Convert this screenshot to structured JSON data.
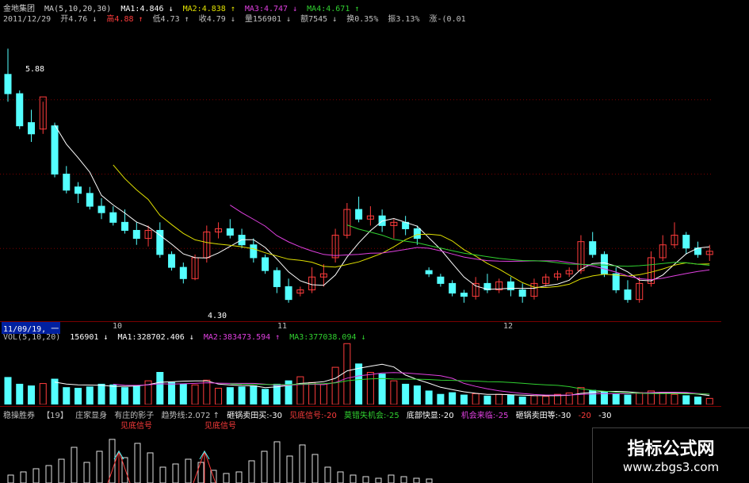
{
  "colors": {
    "bg": "#000000",
    "up": "#ff3c3c",
    "down": "#54ffff",
    "ma5": "#ffffff",
    "ma10": "#e0e000",
    "ma20": "#e040e0",
    "ma30": "#30d030",
    "grid": "#7a0000",
    "text": "#c0c0c0"
  },
  "header": {
    "stock_name": "金地集团",
    "ma_label": "MA(5,10,20,30)",
    "ma1": "MA1:4.846 ↓",
    "ma2": "MA2:4.838 ↑",
    "ma3": "MA3:4.747 ↓",
    "ma4": "MA4:4.671 ↑",
    "date": "2011/12/29",
    "open": "开4.76 ↓",
    "high": "高4.88 ↑",
    "low": "低4.73 ↑",
    "close": "收4.79 ↓",
    "volume": "量156901 ↓",
    "amount": "额7545 ↓",
    "turnover": "换0.35%",
    "amplitude": "振3.13%",
    "change": "涨-(0.01"
  },
  "price_labels": {
    "high_mark": "5.88",
    "low_mark": "4.30"
  },
  "date_axis": {
    "cursor": "11/09/19, 一",
    "m10": "10",
    "m11": "11",
    "m12": "12"
  },
  "volume_header": {
    "label": "VOL(5,10,20)",
    "vol": "156901 ↓",
    "ma1": "MA1:328702.406 ↓",
    "ma2": "MA2:383473.594 ↑",
    "ma3": "MA3:377038.094 ↓"
  },
  "indicator_header": {
    "name": "稳操胜券",
    "param": "【19】",
    "text1": "庄家显身",
    "text2": "有庄的影子",
    "text3": "趋势线:2.072 ↑",
    "text4": "砸锅卖田买:-30",
    "text5": "见底信号:-20",
    "text6": "莫错失机会:-25",
    "text7": "底部快显:-20",
    "text8": "机会来临:-25",
    "text9": "砸锅卖田等:-30",
    "text10": "-20",
    "text11": "-30"
  },
  "signals": [
    "见底信号",
    "见底信号"
  ],
  "watermark": {
    "title": "指标公式网",
    "url": "www.zbgs3.com"
  },
  "chart_data": {
    "type": "candlestick",
    "candles": [
      [
        5.72,
        5.88,
        5.6,
        5.55
      ],
      [
        5.6,
        5.62,
        5.4,
        5.38
      ],
      [
        5.42,
        5.5,
        5.35,
        5.3
      ],
      [
        5.38,
        5.55,
        5.58,
        5.35
      ],
      [
        5.4,
        5.42,
        5.1,
        5.08
      ],
      [
        5.1,
        5.15,
        5.0,
        4.98
      ],
      [
        5.02,
        5.05,
        4.98,
        4.92
      ],
      [
        4.98,
        5.02,
        4.9,
        4.88
      ],
      [
        4.9,
        4.95,
        4.86,
        4.82
      ],
      [
        4.86,
        4.9,
        4.8,
        4.78
      ],
      [
        4.8,
        4.88,
        4.75,
        4.73
      ],
      [
        4.75,
        4.8,
        4.7,
        4.66
      ],
      [
        4.7,
        4.78,
        4.75,
        4.65
      ],
      [
        4.75,
        4.8,
        4.6,
        4.58
      ],
      [
        4.6,
        4.62,
        4.52,
        4.5
      ],
      [
        4.52,
        4.55,
        4.45,
        4.42
      ],
      [
        4.45,
        4.6,
        4.58,
        4.44
      ],
      [
        4.58,
        4.78,
        4.74,
        4.55
      ],
      [
        4.74,
        4.8,
        4.76,
        4.7
      ],
      [
        4.76,
        4.82,
        4.72,
        4.7
      ],
      [
        4.72,
        4.76,
        4.66,
        4.64
      ],
      [
        4.66,
        4.7,
        4.58,
        4.55
      ],
      [
        4.58,
        4.6,
        4.5,
        4.48
      ],
      [
        4.5,
        4.52,
        4.4,
        4.36
      ],
      [
        4.4,
        4.45,
        4.32,
        4.3
      ],
      [
        4.36,
        4.4,
        4.38,
        4.34
      ],
      [
        4.38,
        4.52,
        4.46,
        4.36
      ],
      [
        4.46,
        4.54,
        4.48,
        4.4
      ],
      [
        4.58,
        4.76,
        4.72,
        4.55
      ],
      [
        4.72,
        4.92,
        4.88,
        4.7
      ],
      [
        4.88,
        4.96,
        4.82,
        4.8
      ],
      [
        4.82,
        4.9,
        4.84,
        4.78
      ],
      [
        4.84,
        4.88,
        4.78,
        4.74
      ],
      [
        4.78,
        4.82,
        4.8,
        4.7
      ],
      [
        4.8,
        4.84,
        4.76,
        4.72
      ],
      [
        4.76,
        4.78,
        4.7,
        4.66
      ],
      [
        4.5,
        4.52,
        4.48,
        4.46
      ],
      [
        4.46,
        4.48,
        4.42,
        4.4
      ],
      [
        4.42,
        4.44,
        4.36,
        4.34
      ],
      [
        4.36,
        4.38,
        4.34,
        4.3
      ],
      [
        4.34,
        4.46,
        4.42,
        4.32
      ],
      [
        4.42,
        4.48,
        4.38,
        4.36
      ],
      [
        4.38,
        4.45,
        4.43,
        4.36
      ],
      [
        4.43,
        4.46,
        4.38,
        4.34
      ],
      [
        4.38,
        4.42,
        4.34,
        4.3
      ],
      [
        4.34,
        4.45,
        4.42,
        4.32
      ],
      [
        4.42,
        4.48,
        4.46,
        4.4
      ],
      [
        4.46,
        4.5,
        4.48,
        4.44
      ],
      [
        4.48,
        4.52,
        4.5,
        4.46
      ],
      [
        4.5,
        4.72,
        4.68,
        4.48
      ],
      [
        4.68,
        4.74,
        4.6,
        4.58
      ],
      [
        4.6,
        4.62,
        4.48,
        4.46
      ],
      [
        4.48,
        4.52,
        4.38,
        4.36
      ],
      [
        4.38,
        4.44,
        4.32,
        4.3
      ],
      [
        4.32,
        4.46,
        4.42,
        4.3
      ],
      [
        4.42,
        4.62,
        4.58,
        4.4
      ],
      [
        4.58,
        4.72,
        4.66,
        4.56
      ],
      [
        4.66,
        4.8,
        4.72,
        4.64
      ],
      [
        4.72,
        4.74,
        4.64,
        4.6
      ],
      [
        4.64,
        4.68,
        4.6,
        4.58
      ],
      [
        4.6,
        4.66,
        4.62,
        4.56
      ]
    ],
    "volume": [
      80,
      60,
      55,
      62,
      75,
      50,
      48,
      52,
      60,
      58,
      50,
      55,
      70,
      95,
      65,
      60,
      58,
      72,
      48,
      50,
      52,
      55,
      45,
      60,
      70,
      82,
      65,
      60,
      110,
      180,
      120,
      95,
      90,
      70,
      60,
      55,
      40,
      30,
      35,
      28,
      32,
      25,
      30,
      28,
      22,
      26,
      24,
      30,
      34,
      50,
      42,
      38,
      30,
      28,
      35,
      40,
      36,
      30,
      26,
      22,
      18
    ]
  }
}
